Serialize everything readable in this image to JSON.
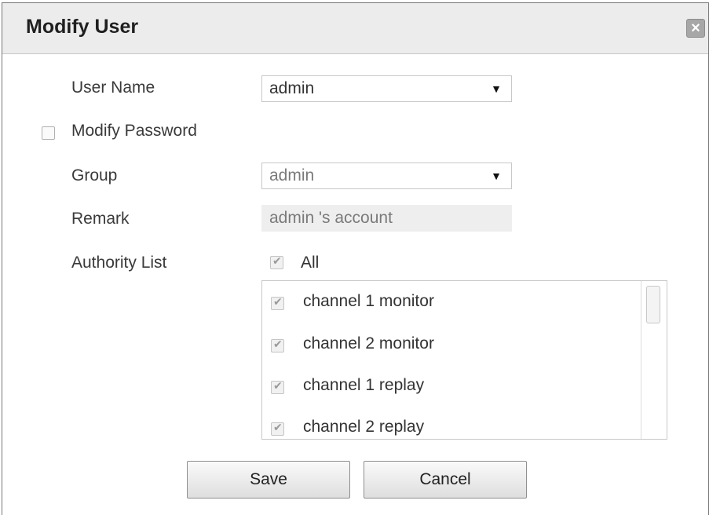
{
  "dialog": {
    "title": "Modify User",
    "close_label": "×"
  },
  "form": {
    "user_name_label": "User Name",
    "user_name_value": "admin",
    "modify_password_label": "Modify Password",
    "modify_password_checked": false,
    "group_label": "Group",
    "group_value": "admin",
    "remark_label": "Remark",
    "remark_value": "admin 's account",
    "authority_label": "Authority List",
    "all_label": "All",
    "all_checked": true
  },
  "authority_items": [
    {
      "label": "channel 1 monitor",
      "checked": true
    },
    {
      "label": "channel 2 monitor",
      "checked": true
    },
    {
      "label": "channel 1 replay",
      "checked": true
    },
    {
      "label": "channel 2 replay",
      "checked": true
    }
  ],
  "buttons": {
    "save": "Save",
    "cancel": "Cancel"
  }
}
